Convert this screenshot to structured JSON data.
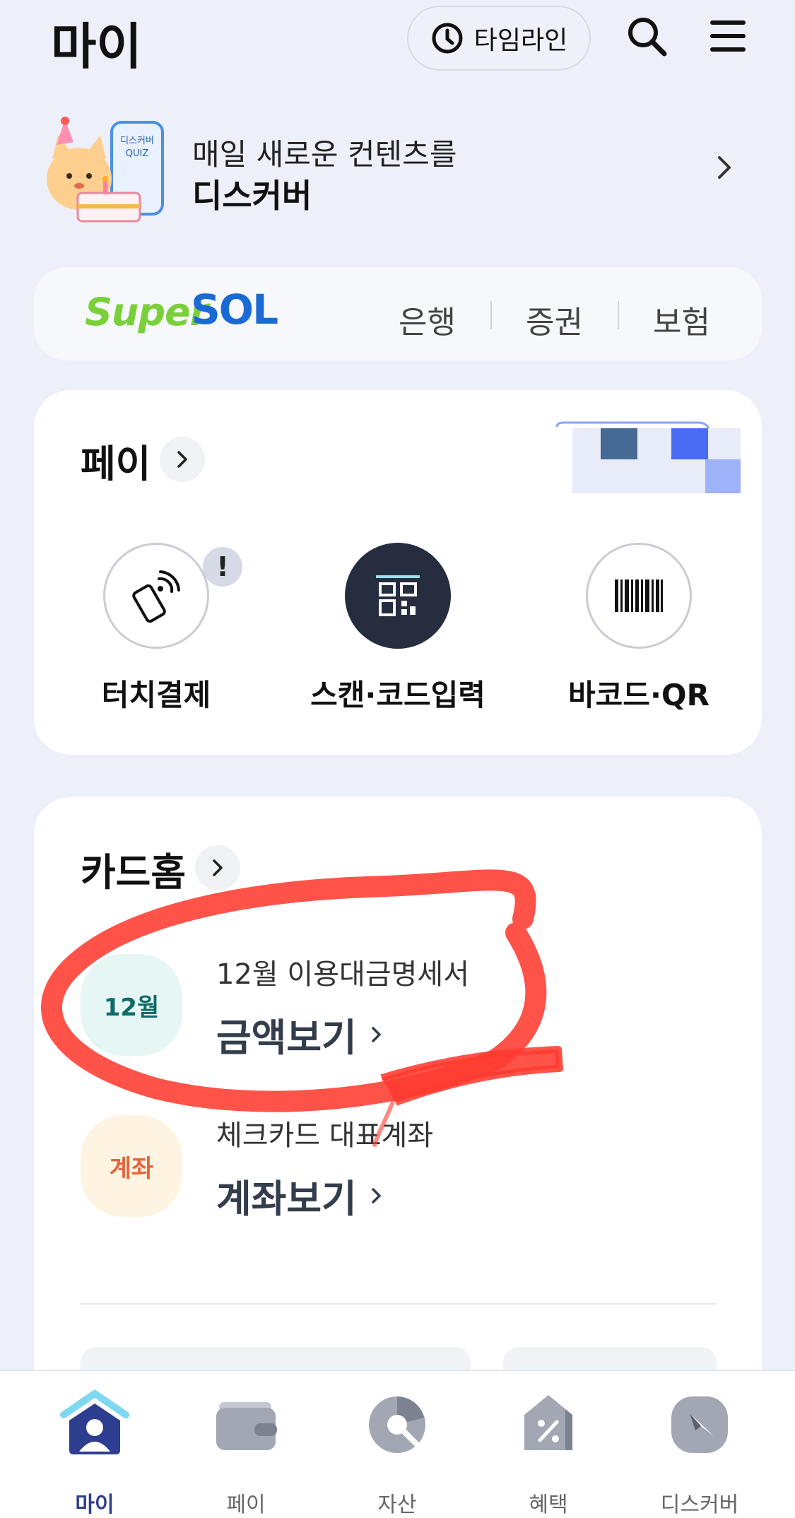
{
  "header": {
    "title": "마이",
    "timeline_label": "타임라인",
    "search_icon": "search-icon",
    "menu_icon": "hamburger-menu-icon"
  },
  "discover_banner": {
    "line1": "매일 새로운 컨텐츠를",
    "line2": "디스커버",
    "art_badge_line1": "디스커버",
    "art_badge_line2": "QUIZ"
  },
  "super_sol": {
    "logo_super": "Super",
    "logo_sol": "SOL",
    "tabs": [
      "은행",
      "증권",
      "보험"
    ]
  },
  "pay": {
    "title": "페이",
    "items": [
      {
        "label": "터치결제",
        "icon": "phone-nfc-icon",
        "badge": "!"
      },
      {
        "label": "스캔·코드입력",
        "icon": "qr-scan-icon"
      },
      {
        "label": "바코드·QR",
        "icon": "barcode-icon"
      }
    ]
  },
  "card_home": {
    "title": "카드홈",
    "rows": [
      {
        "badge": "12월",
        "sub": "12월 이용대금명세서",
        "action": "금액보기",
        "badge_bg": "#e6f6f5",
        "badge_color": "#116a6a"
      },
      {
        "badge": "계좌",
        "sub": "체크카드 대표계좌",
        "action": "계좌보기",
        "badge_bg": "#fff4e2",
        "badge_color": "#e5643b"
      }
    ]
  },
  "bottom_nav": [
    {
      "label": "마이",
      "icon": "home-person-icon",
      "active": true
    },
    {
      "label": "페이",
      "icon": "wallet-icon",
      "active": false
    },
    {
      "label": "자산",
      "icon": "pie-chart-icon",
      "active": false
    },
    {
      "label": "혜택",
      "icon": "discount-tag-icon",
      "active": false
    },
    {
      "label": "디스커버",
      "icon": "compass-icon",
      "active": false
    }
  ],
  "colors": {
    "background": "#edf0f8",
    "accent_navy": "#2d3d8f",
    "annotation_red": "#ff3b30",
    "sol_green": "#7ad03a",
    "sol_blue": "#1a6ad6"
  }
}
